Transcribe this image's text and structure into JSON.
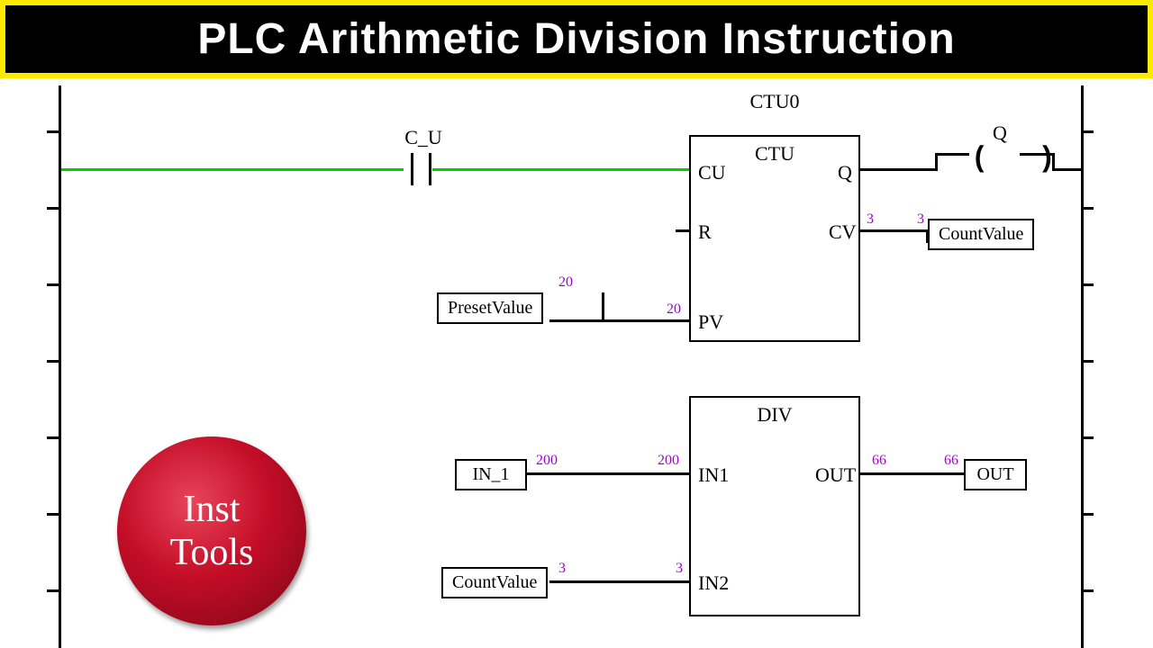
{
  "title": "PLC Arithmetic Division Instruction",
  "logo": {
    "line1": "Inst",
    "line2": "Tools"
  },
  "rung1": {
    "contact_label": "C_U",
    "coil_label": "Q",
    "block": {
      "instance": "CTU0",
      "type": "CTU",
      "pins": {
        "cu": "CU",
        "r": "R",
        "pv": "PV",
        "q": "Q",
        "cv": "CV"
      }
    },
    "preset": {
      "tag": "PresetValue",
      "v1": "20",
      "v2": "20"
    },
    "cv": {
      "v1": "3",
      "v2": "3",
      "tag": "CountValue"
    }
  },
  "rung2": {
    "block": {
      "type": "DIV",
      "pins": {
        "in1": "IN1",
        "in2": "IN2",
        "out": "OUT"
      }
    },
    "in1": {
      "tag": "IN_1",
      "v1": "200",
      "v2": "200"
    },
    "in2": {
      "tag": "CountValue",
      "v1": "3",
      "v2": "3"
    },
    "out": {
      "v1": "66",
      "v2": "66",
      "tag": "OUT"
    }
  }
}
